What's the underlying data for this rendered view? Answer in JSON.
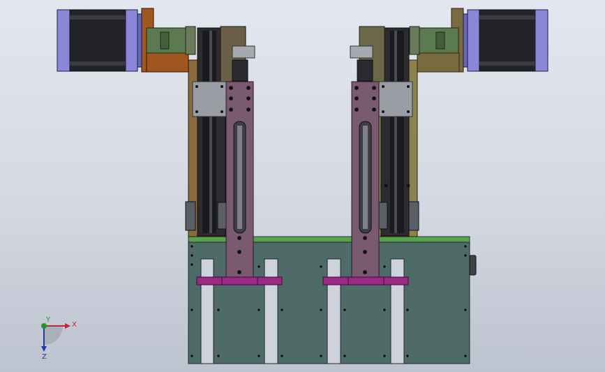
{
  "view": {
    "background_top": "#e3e7ef",
    "background_bottom": "#bdc3cf"
  },
  "triad": {
    "x_label": "X",
    "y_label": "Y",
    "z_label": "Z",
    "x_color": "#c0282d",
    "y_color": "#1f9a2a",
    "z_color": "#1f3ca8"
  },
  "colors": {
    "base_plate": "#4f6b68",
    "base_top_strip": "#58a24e",
    "motor_body": "#222428",
    "motor_flange": "#8a86d8",
    "slider_arm": "#7a5a70",
    "purple_bar": "#9a2a86",
    "coupling_green": "#5c7a4f",
    "left_mount_brown": "#a0561e",
    "right_mount_olive": "#7a6a3f",
    "gray_block": "#9a9ea4",
    "frame_olive": "#8c8450"
  }
}
